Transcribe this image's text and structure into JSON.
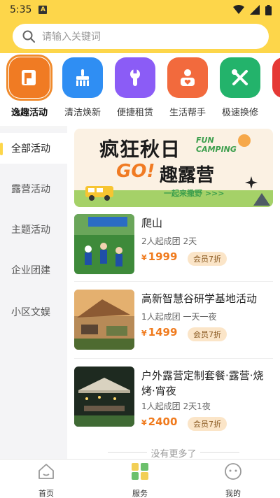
{
  "status_bar": {
    "time": "5:35",
    "notification_glyph": "A"
  },
  "search": {
    "placeholder": "请输入关键词"
  },
  "categories": [
    {
      "label": "逸趣活动",
      "icon": "flag-icon",
      "color": "#f07b23",
      "active": true
    },
    {
      "label": "清洁焕新",
      "icon": "broom-icon",
      "color": "#2f8ef3"
    },
    {
      "label": "便捷租赁",
      "icon": "wrench-icon",
      "color": "#8b5cf6"
    },
    {
      "label": "生活帮手",
      "icon": "person-heart-icon",
      "color": "#f26a3d"
    },
    {
      "label": "极速换修",
      "icon": "tools-icon",
      "color": "#23b36b"
    }
  ],
  "sidebar": {
    "items": [
      {
        "label": "全部活动",
        "active": true
      },
      {
        "label": "露营活动"
      },
      {
        "label": "主题活动"
      },
      {
        "label": "企业团建"
      },
      {
        "label": "小区文娱"
      }
    ]
  },
  "banner": {
    "line1": "疯狂秋日",
    "fun_line1": "FUN",
    "fun_line2": "CAMPING",
    "go_text": "GO!",
    "line2": "趣露营",
    "slogan": "一起来撒野 >>>"
  },
  "activities": [
    {
      "title": "爬山",
      "meta": "2人起成团 2天",
      "currency": "¥",
      "price": "1999",
      "badge": "会员7折"
    },
    {
      "title": "高新智慧谷研学基地活动",
      "meta": "1人起成团 一天一夜",
      "currency": "¥",
      "price": "1499",
      "badge": "会员7折"
    },
    {
      "title": "户外露营定制套餐·露营·烧烤·宵夜",
      "meta": "1人起成团 2天1夜",
      "currency": "¥",
      "price": "2400",
      "badge": "会员7折"
    }
  ],
  "footer_note": "没有更多了",
  "tabbar": [
    {
      "label": "首页",
      "icon": "home-icon"
    },
    {
      "label": "服务",
      "icon": "services-icon",
      "active": true
    },
    {
      "label": "我的",
      "icon": "profile-icon"
    }
  ],
  "colors": {
    "brand_yellow": "#fdd64a",
    "accent_orange": "#f07b1e",
    "badge_bg": "#fbe5c8"
  }
}
